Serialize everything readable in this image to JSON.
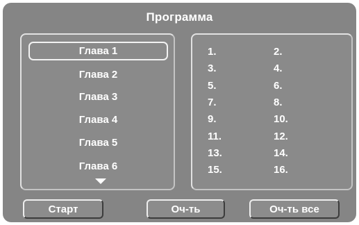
{
  "title": "Программа",
  "chapters": [
    "Глава 1",
    "Глава 2",
    "Глава 3",
    "Глава 4",
    "Глава 5",
    "Глава 6"
  ],
  "selected_chapter_index": 0,
  "program_slots": [
    "1.",
    "2.",
    "3.",
    "4.",
    "5.",
    "6.",
    "7.",
    "8.",
    "9.",
    "10.",
    "11.",
    "12.",
    "13.",
    "14.",
    "15.",
    "16."
  ],
  "buttons": {
    "start": "Старт",
    "clear": "Оч-ть",
    "clear_all": "Оч-ть все"
  },
  "colors": {
    "background": "#858585",
    "text": "#ffffff",
    "highlight_border": "#f2f2f2"
  }
}
